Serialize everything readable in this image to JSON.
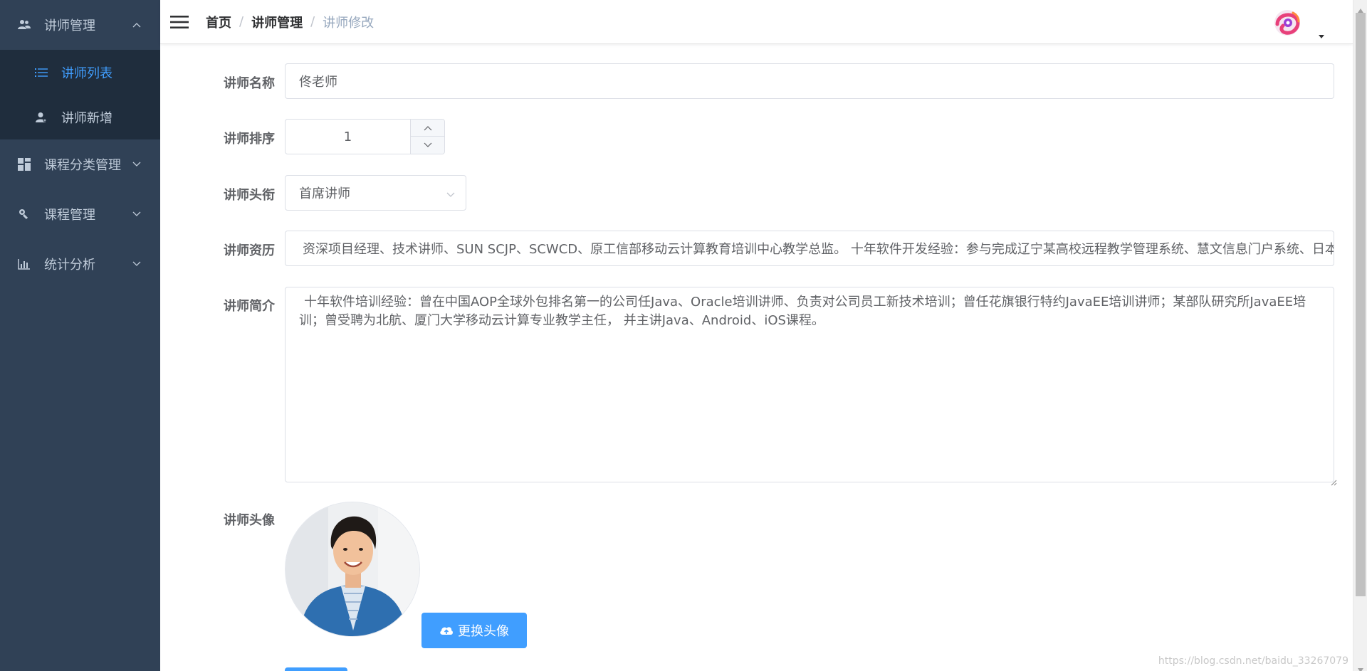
{
  "sidebar": {
    "groups": [
      {
        "label": "讲师管理",
        "icon": "users-icon",
        "expanded": true,
        "items": [
          {
            "label": "讲师列表",
            "icon": "list-icon",
            "active": true
          },
          {
            "label": "讲师新增",
            "icon": "user-add-icon",
            "active": false
          }
        ]
      },
      {
        "label": "课程分类管理",
        "icon": "grid-icon",
        "expanded": false
      },
      {
        "label": "课程管理",
        "icon": "tools-icon",
        "expanded": false
      },
      {
        "label": "统计分析",
        "icon": "bar-chart-icon",
        "expanded": false
      }
    ]
  },
  "navbar": {
    "breadcrumb": [
      "首页",
      "讲师管理",
      "讲师修改"
    ],
    "separator": "/"
  },
  "form": {
    "name": {
      "label": "讲师名称",
      "value": "佟老师"
    },
    "sort": {
      "label": "讲师排序",
      "value": "1"
    },
    "level": {
      "label": "讲师头衔",
      "value": "首席讲师"
    },
    "career": {
      "label": "讲师资历",
      "value": "资深项目经理、技术讲师、SUN SCJP、SCWCD、原工信部移动云计算教育培训中心教学总监。 十年软件开发经验：参与完成辽宁某高校远程教学管理系统、慧文信息门户系统、日本麦"
    },
    "intro": {
      "label": "讲师简介",
      "value": "十年软件培训经验：曾在中国AOP全球外包排名第一的公司任Java、Oracle培训讲师、负责对公司员工新技术培训；曾任花旗银行特约JavaEE培训讲师；某部队研究所JavaEE培训；曾受聘为北航、厦门大学移动云计算专业教学主任， 并主讲Java、Android、iOS课程。"
    },
    "avatar": {
      "label": "讲师头像",
      "button_label": "更换头像"
    }
  },
  "watermark": "https://blog.csdn.net/baidu_33267079",
  "colors": {
    "sidebar_bg": "#304156",
    "submenu_bg": "#1f2d3d",
    "accent": "#409eff",
    "menu_text": "#bfcbd9"
  }
}
